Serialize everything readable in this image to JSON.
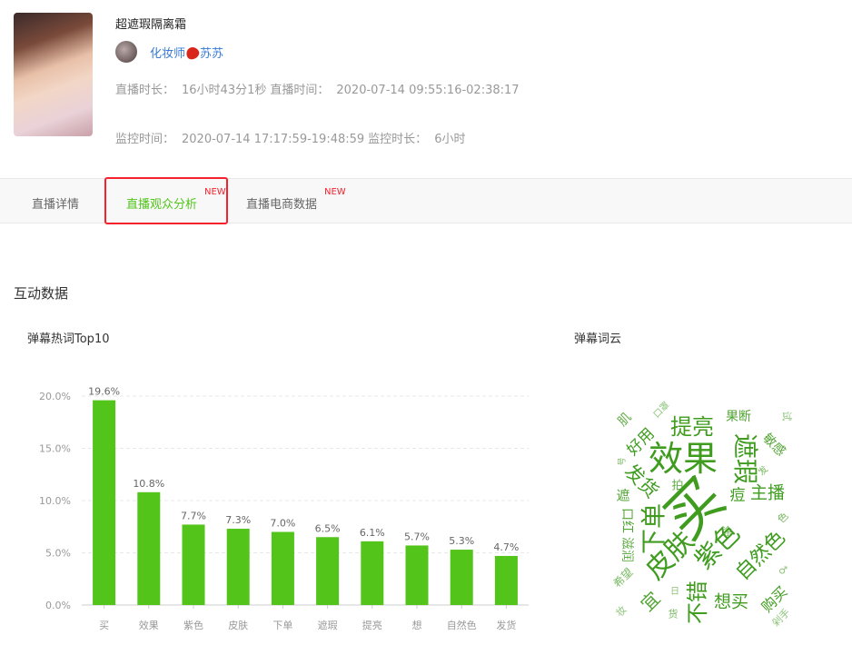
{
  "header": {
    "title": "超遮瑕隔离霜",
    "anchor_name_prefix": "化妆师",
    "anchor_name_suffix": "苏苏",
    "live_duration_label": "直播时长：",
    "live_duration": "16小时43分1秒",
    "live_time_label": "直播时间：",
    "live_time": "2020-07-14 09:55:16-02:38:17",
    "monitor_time_label": "监控时间：",
    "monitor_time": "2020-07-14 17:17:59-19:48:59",
    "monitor_duration_label": "监控时长：",
    "monitor_duration": "6小时"
  },
  "tabs": [
    {
      "label": "直播详情",
      "badge": ""
    },
    {
      "label": "直播观众分析",
      "badge": "NEW",
      "active": true
    },
    {
      "label": "直播电商数据",
      "badge": "NEW"
    }
  ],
  "section_title": "互动数据",
  "colors": {
    "accent": "#52c41a",
    "highlight": "#f5222d",
    "cloud": "#3f9c1f"
  },
  "chart_data": {
    "type": "bar",
    "title": "弹幕热词Top10",
    "categories": [
      "买",
      "效果",
      "紫色",
      "皮肤",
      "下单",
      "遮瑕",
      "提亮",
      "想",
      "自然色",
      "发货"
    ],
    "values": [
      19.6,
      10.8,
      7.7,
      7.3,
      7.0,
      6.5,
      6.1,
      5.7,
      5.3,
      4.7
    ],
    "data_labels": [
      "19.6%",
      "10.8%",
      "7.7%",
      "7.3%",
      "7.0%",
      "6.5%",
      "6.1%",
      "5.7%",
      "5.3%",
      "4.7%"
    ],
    "yticks": [
      "0.0%",
      "5.0%",
      "10.0%",
      "15.0%",
      "20.0%"
    ],
    "ylim": [
      0,
      20
    ],
    "grid": true,
    "color": "#52c41a"
  },
  "wordcloud": {
    "title": "弹幕词云",
    "words": [
      "买",
      "效果",
      "提亮",
      "遮瑕",
      "主播",
      "下单",
      "皮肤",
      "紫色",
      "自然色",
      "不错",
      "想买",
      "购买",
      "好用",
      "发货",
      "肌",
      "果断",
      "敏感",
      "痘",
      "拍",
      "遮",
      "口红",
      "滋润",
      "希望",
      "宜",
      "涂",
      "色",
      "发",
      "号",
      "妆",
      "货",
      "日",
      "试",
      "剁手",
      "♂",
      "口罩"
    ]
  }
}
